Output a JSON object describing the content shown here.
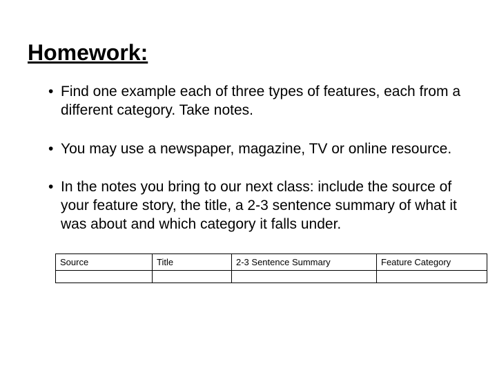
{
  "title": "Homework:",
  "bullets": [
    "Find one example each of three types of features, each from a different category. Take notes.",
    "You may use a newspaper, magazine, TV or online resource.",
    "In the notes you bring to our next class: include the source of your feature story, the title, a 2-3 sentence summary of what it was about and which category it falls under."
  ],
  "table": {
    "headers": [
      "Source",
      "Title",
      "2-3 Sentence Summary",
      "Feature Category"
    ]
  }
}
